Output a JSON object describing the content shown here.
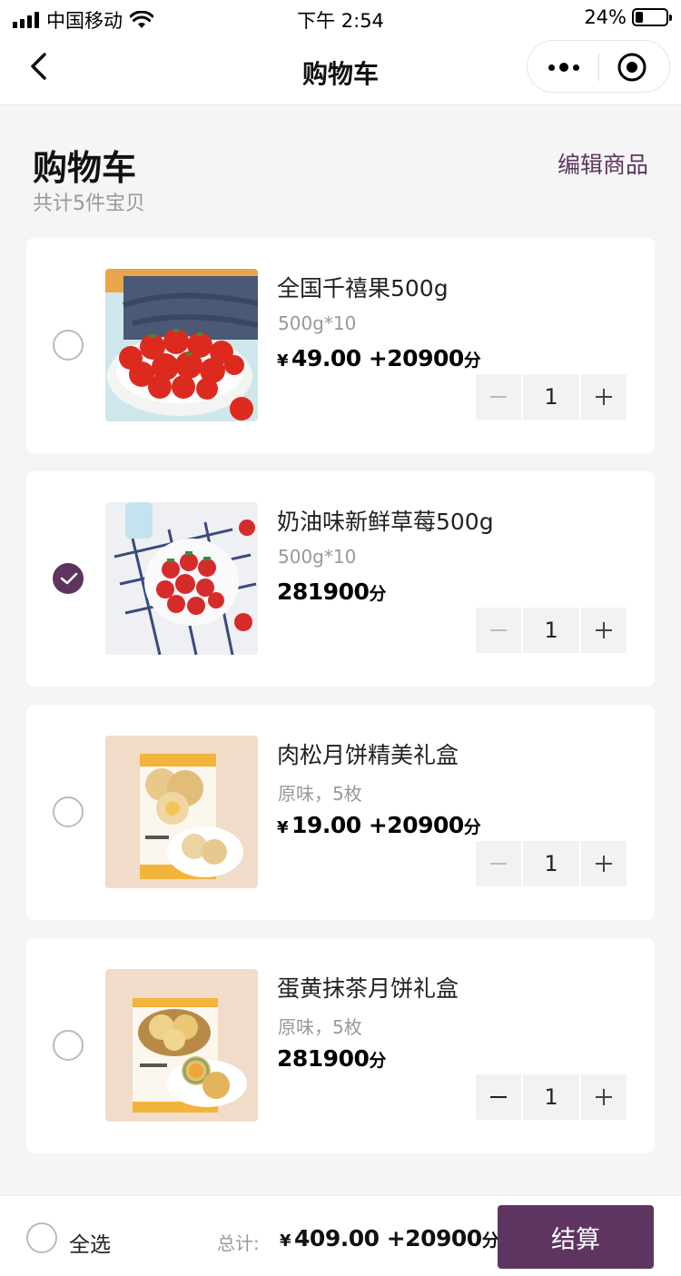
{
  "status_bar": {
    "carrier": "中国移动",
    "time": "下午 2:54",
    "battery": "24%",
    "battery_level": 0.24
  },
  "nav": {
    "title": "购物车"
  },
  "header": {
    "title": "购物车",
    "subtitle": "共计5件宝贝",
    "edit_label": "编辑商品"
  },
  "colors": {
    "accent": "#5e3561"
  },
  "items": [
    {
      "name": "全国千禧果500g",
      "spec": "500g*10",
      "currency": "¥",
      "price": "49.00",
      "points": "+20900",
      "points_unit": "分",
      "quantity": "1",
      "checked": false,
      "minus_disabled": true,
      "image": "cherry-tomatoes"
    },
    {
      "name": "奶油味新鲜草莓500g",
      "spec": "500g*10",
      "currency": "",
      "price": "",
      "points": "281900",
      "points_unit": "分",
      "quantity": "1",
      "checked": true,
      "minus_disabled": true,
      "image": "strawberries"
    },
    {
      "name": "肉松月饼精美礼盒",
      "spec": "原味，5枚",
      "currency": "¥",
      "price": "19.00",
      "points": "+20900",
      "points_unit": "分",
      "quantity": "1",
      "checked": false,
      "minus_disabled": true,
      "image": "pork-floss-mooncake-box"
    },
    {
      "name": "蛋黄抹茶月饼礼盒",
      "spec": "原味，5枚",
      "currency": "",
      "price": "",
      "points": "281900",
      "points_unit": "分",
      "quantity": "1",
      "checked": false,
      "minus_disabled": false,
      "image": "matcha-yolk-mooncake-box"
    }
  ],
  "footer": {
    "select_all_label": "全选",
    "total_label": "总计:",
    "total_currency": "¥",
    "total_price": "409.00",
    "total_points": "+20900",
    "total_points_unit": "分",
    "checkout_label": "结算"
  }
}
